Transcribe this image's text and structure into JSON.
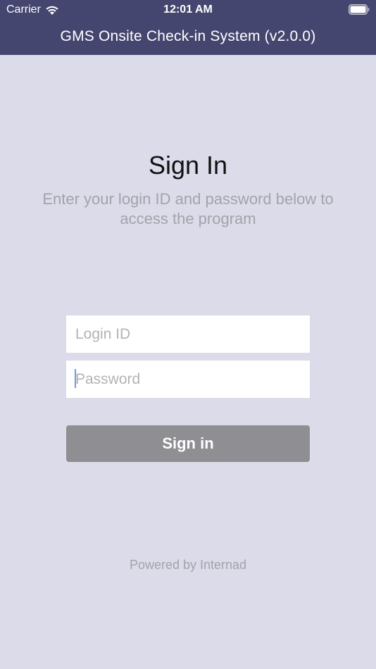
{
  "status_bar": {
    "carrier": "Carrier",
    "time": "12:01 AM"
  },
  "header": {
    "title": "GMS Onsite Check-in System (v2.0.0)"
  },
  "signin": {
    "title": "Sign In",
    "subtitle": "Enter your login ID and password below to access the program",
    "login_placeholder": "Login ID",
    "password_placeholder": "Password",
    "button_label": "Sign in"
  },
  "footer": {
    "text": "Powered by Internad"
  },
  "colors": {
    "header_bg": "#45466f",
    "page_bg": "#dcdbe9",
    "button_bg": "#8e8e93",
    "muted_text": "#a3a3ab"
  },
  "icons": [
    "wifi-icon",
    "battery-icon"
  ]
}
